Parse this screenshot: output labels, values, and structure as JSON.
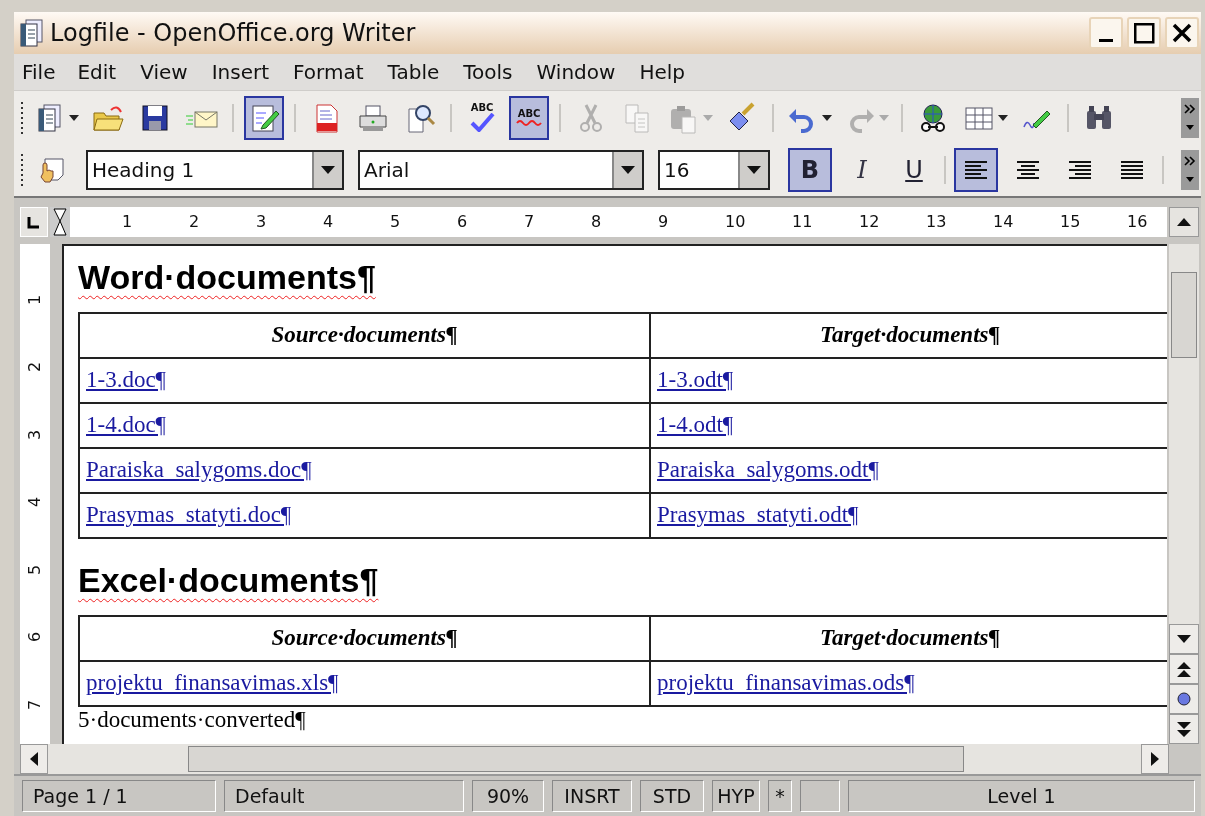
{
  "window": {
    "title": "Logfile - OpenOffice.org Writer"
  },
  "menu": [
    "File",
    "Edit",
    "View",
    "Insert",
    "Format",
    "Table",
    "Tools",
    "Window",
    "Help"
  ],
  "toolbar": [
    {
      "kind": "new",
      "dropdown": true,
      "selected": false,
      "disabled": false
    },
    {
      "kind": "open",
      "dropdown": false,
      "selected": false,
      "disabled": false
    },
    {
      "kind": "save",
      "dropdown": false,
      "selected": false,
      "disabled": false
    },
    {
      "kind": "mail",
      "dropdown": false,
      "selected": false,
      "disabled": false
    },
    {
      "kind": "separator"
    },
    {
      "kind": "edit",
      "dropdown": false,
      "selected": true,
      "disabled": false
    },
    {
      "kind": "separator"
    },
    {
      "kind": "pdf",
      "dropdown": false,
      "selected": false,
      "disabled": false
    },
    {
      "kind": "print",
      "dropdown": false,
      "selected": false,
      "disabled": false
    },
    {
      "kind": "preview",
      "dropdown": false,
      "selected": false,
      "disabled": false
    },
    {
      "kind": "separator"
    },
    {
      "kind": "spell",
      "text": "ABC",
      "dropdown": false,
      "selected": false,
      "disabled": false
    },
    {
      "kind": "autospell",
      "text": "ABC",
      "dropdown": false,
      "selected": true,
      "disabled": false
    },
    {
      "kind": "separator"
    },
    {
      "kind": "cut",
      "dropdown": false,
      "selected": false,
      "disabled": true
    },
    {
      "kind": "copy",
      "dropdown": false,
      "selected": false,
      "disabled": true
    },
    {
      "kind": "paste",
      "dropdown": true,
      "selected": false,
      "disabled": true
    },
    {
      "kind": "brush",
      "dropdown": false,
      "selected": false,
      "disabled": false
    },
    {
      "kind": "separator"
    },
    {
      "kind": "undo",
      "dropdown": true,
      "selected": false,
      "disabled": false
    },
    {
      "kind": "redo",
      "dropdown": true,
      "selected": false,
      "disabled": true
    },
    {
      "kind": "separator"
    },
    {
      "kind": "hyperlink",
      "dropdown": false,
      "selected": false,
      "disabled": false
    },
    {
      "kind": "table",
      "dropdown": true,
      "selected": false,
      "disabled": false
    },
    {
      "kind": "draw",
      "dropdown": false,
      "selected": false,
      "disabled": false
    },
    {
      "kind": "separator"
    },
    {
      "kind": "find",
      "dropdown": false,
      "selected": false,
      "disabled": false
    }
  ],
  "formatting": {
    "style": "Heading 1",
    "font": "Arial",
    "size": "16",
    "buttons": [
      {
        "label": "B",
        "kind": "bold",
        "selected": true
      },
      {
        "label": "I",
        "kind": "italic",
        "selected": false
      },
      {
        "label": "U",
        "kind": "underline",
        "selected": false
      }
    ],
    "align": [
      {
        "kind": "left",
        "selected": true
      },
      {
        "kind": "center",
        "selected": false
      },
      {
        "kind": "right",
        "selected": false
      },
      {
        "kind": "justify",
        "selected": false
      }
    ]
  },
  "ruler": [
    "1",
    "2",
    "3",
    "4",
    "5",
    "6",
    "7",
    "8",
    "9",
    "10",
    "11",
    "12",
    "13",
    "14",
    "15",
    "16"
  ],
  "vertical_ruler": [
    "1",
    "2",
    "3",
    "4",
    "5",
    "6",
    "7"
  ],
  "document": [
    {
      "kind": "heading",
      "text": "Word·documents¶",
      "misspelled": true
    },
    {
      "kind": "table",
      "header": [
        "Source·documents¶",
        "Target·documents¶"
      ],
      "rows": [
        [
          "1-3.doc¶",
          "1-3.odt¶"
        ],
        [
          "1-4.doc¶",
          "1-4.odt¶"
        ],
        [
          "Paraiska_salygoms.doc¶",
          "Paraiska_salygoms.odt¶"
        ],
        [
          "Prasymas_statyti.doc¶",
          "Prasymas_statyti.odt¶"
        ]
      ]
    },
    {
      "kind": "heading",
      "text": "Excel·documents¶",
      "misspelled": true
    },
    {
      "kind": "table",
      "header": [
        "Source·documents¶",
        "Target·documents¶"
      ],
      "rows": [
        [
          "projektu_finansavimas.xls¶",
          "projektu_finansavimas.ods¶"
        ]
      ]
    },
    {
      "kind": "paragraph",
      "text": "5·documents·converted¶",
      "misspelled": false
    }
  ],
  "status_bar": [
    "Page 1 / 1",
    "Default",
    "90%",
    "INSRT",
    "STD",
    "HYP",
    "*",
    "Level 1"
  ]
}
